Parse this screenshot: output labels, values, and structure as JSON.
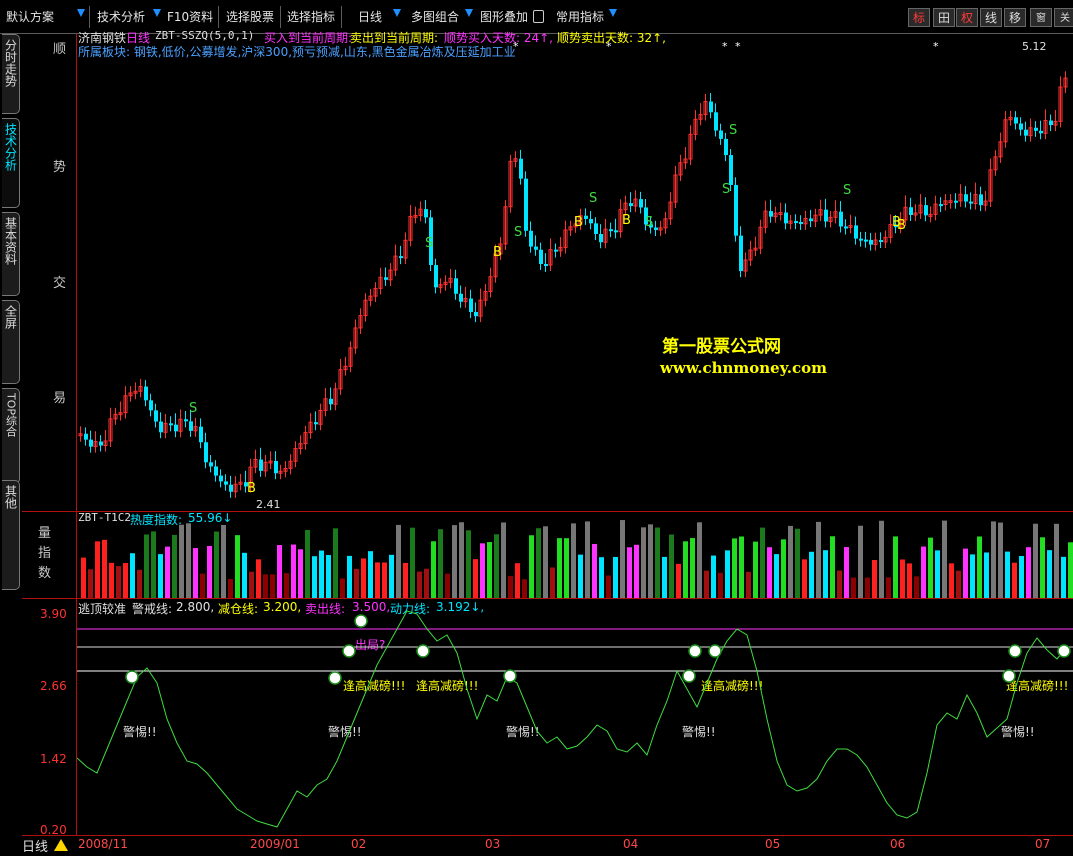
{
  "toolbar": {
    "items": [
      "默认方案",
      "技术分析",
      "F10资料",
      "选择股票",
      "选择指标",
      "日线",
      "多图组合",
      "图形叠加",
      "常用指标"
    ],
    "right_buttons": [
      "标",
      "田",
      "权",
      "线",
      "移",
      "窗",
      "关"
    ]
  },
  "sidebar": {
    "tabs": [
      {
        "label": "分时走势",
        "active": false
      },
      {
        "label": "技术分析",
        "active": true
      },
      {
        "label": "基本资料",
        "active": false
      },
      {
        "label": "全屏",
        "active": false
      },
      {
        "label": "TOP综合",
        "active": false
      },
      {
        "label": "其他",
        "active": false
      }
    ]
  },
  "left_labels": {
    "main": [
      "顺",
      "势",
      "交",
      "易"
    ],
    "volume": [
      "量",
      "指",
      "数"
    ],
    "osc_values": [
      "3.90",
      "2.66",
      "1.42",
      "0.20"
    ]
  },
  "main_panel": {
    "stock": "济南钢铁",
    "period": "日线",
    "indicator": "ZBT-SSZQ(5,0,1)",
    "line1_part1": "买入到当前周期:",
    "line1_part2": "卖出到当前周期:",
    "line1_part3": "顺势买入天数: 24↑,",
    "line1_part4": "顺势卖出天数: 32↑,",
    "sector_text": "所属板块: 钢铁,低价,公募增发,沪深300,预亏预减,山东,黑色金属冶炼及压延加工业",
    "watermark_cn": "第一股票公式网",
    "watermark_url": "www.chnmoney.com",
    "high_label": "5.12",
    "low_label": "2.41",
    "buy_marker": "B",
    "sell_marker": "S"
  },
  "volume_panel": {
    "indicator": "ZBT-T1C2",
    "label": "热度指数:",
    "value": "55.96↓"
  },
  "osc_panel": {
    "name": "逃顶较准",
    "l1_label": "警戒线:",
    "l1_value": "2.800,",
    "l2_label": "减仓线:",
    "l2_value": "3.200,",
    "l3_label": "卖出线:",
    "l3_value": "3.500,",
    "l4_label": "动力线:",
    "l4_value": "3.192↓,",
    "warn_text": "警惕!!",
    "reduce_text": "逢高减磅!!!",
    "out_text": "出局?",
    "sell_line": 3.5,
    "reduce_line": 3.2,
    "warn_line": 2.8,
    "min": 0.2,
    "max": 3.9,
    "power_line": [
      1.35,
      1.2,
      1.1,
      1.5,
      1.9,
      2.3,
      2.7,
      2.85,
      2.6,
      2.0,
      1.6,
      1.3,
      1.25,
      1.1,
      0.9,
      0.7,
      0.5,
      0.4,
      0.3,
      0.25,
      0.2,
      0.5,
      0.8,
      0.7,
      0.9,
      1.0,
      1.3,
      1.7,
      2.1,
      2.5,
      2.9,
      3.2,
      3.5,
      3.8,
      3.75,
      3.5,
      3.3,
      3.4,
      3.1,
      2.5,
      2.0,
      2.4,
      2.3,
      2.7,
      2.6,
      2.2,
      1.8,
      1.6,
      1.7,
      1.5,
      1.55,
      1.7,
      1.9,
      1.8,
      1.5,
      1.45,
      1.6,
      1.4,
      1.9,
      2.3,
      2.8,
      2.5,
      2.2,
      2.6,
      3.0,
      3.3,
      3.5,
      3.4,
      2.8,
      2.0,
      1.3,
      0.9,
      0.8,
      0.85,
      1.0,
      1.3,
      1.5,
      1.5,
      1.4,
      1.2,
      0.9,
      0.6,
      0.4,
      0.35,
      0.45,
      1.1,
      1.9,
      2.1,
      2.0,
      2.4,
      2.1,
      1.7,
      1.85,
      2.0,
      2.6,
      3.1,
      3.35,
      3.15,
      3.0,
      3.2
    ]
  },
  "date_axis": {
    "period_label": "日线",
    "labels": [
      "2008/11",
      "2009/01",
      "02",
      "03",
      "04",
      "05",
      "06",
      "07"
    ]
  },
  "colors": {
    "up": "#ff3232",
    "down": "#00e5ff",
    "axis": "#b01010",
    "power_line": "#3fdc3f",
    "sell_line": "#ff33ff",
    "warn_line": "#ffffff",
    "yellow": "#ffff00",
    "magenta": "#ff33ff",
    "cyan": "#00e5ff"
  }
}
